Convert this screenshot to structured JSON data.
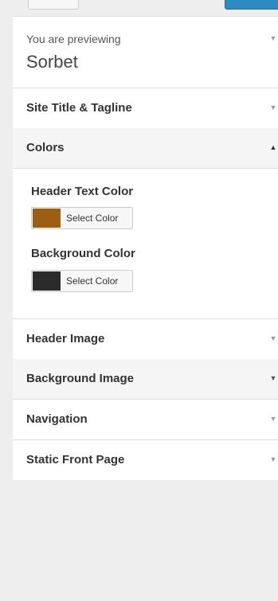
{
  "preview": {
    "label": "You are previewing",
    "theme_name": "Sorbet"
  },
  "sections": {
    "site_title": "Site Title & Tagline",
    "colors": "Colors",
    "header_image": "Header Image",
    "background_image": "Background Image",
    "navigation": "Navigation",
    "static_front_page": "Static Front Page"
  },
  "colors": {
    "header_text_label": "Header Text Color",
    "header_text_value": "#9a5f12",
    "background_label": "Background Color",
    "background_value": "#2b2b2b",
    "select_color_label": "Select Color"
  },
  "icons": {
    "collapsed": "▼",
    "expanded": "▲"
  }
}
